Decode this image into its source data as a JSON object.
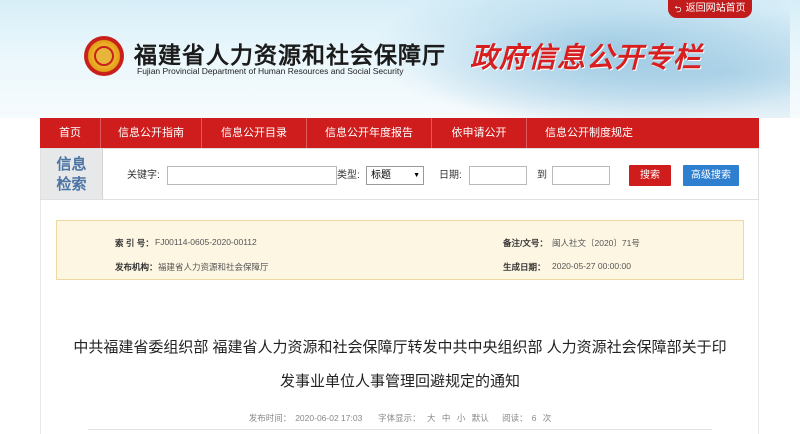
{
  "header": {
    "back_link": "返回网站首页",
    "department_cn": "福建省人力资源和社会保障厅",
    "department_en": "Fujian Provincial Department of Human Resources and Social Security",
    "column_title": "政府信息公开专栏"
  },
  "nav": {
    "items": [
      {
        "label": "首页"
      },
      {
        "label": "信息公开指南"
      },
      {
        "label": "信息公开目录"
      },
      {
        "label": "信息公开年度报告"
      },
      {
        "label": "依申请公开"
      },
      {
        "label": "信息公开制度规定"
      }
    ]
  },
  "search": {
    "title_line1": "信息",
    "title_line2": "检索",
    "keyword_label": "关键字:",
    "keyword_value": "",
    "type_label": "类型:",
    "type_selected": "标题",
    "date_label": "日期:",
    "date_from": "",
    "to_label": "到",
    "date_to": "",
    "search_button": "搜索",
    "advanced_button": "高级搜索"
  },
  "meta": {
    "index_label": "索 引 号：",
    "index_value": "FJ00114-0605-2020-00112",
    "org_label": "发布机构：",
    "org_value": "福建省人力资源和社会保障厅",
    "ref_label": "备注/文号：",
    "ref_value": "闽人社文〔2020〕71号",
    "date_label": "生成日期：",
    "date_value": "2020-05-27 00:00:00"
  },
  "document": {
    "title_line1": "中共福建省委组织部 福建省人力资源和社会保障厅转发中共中央组织部 人力资源社会保障部关于印",
    "title_line2": "发事业单位人事管理回避规定的通知",
    "published_label": "发布时间：",
    "published_value": "2020-06-02 17:03",
    "font_size_label": "字体显示：",
    "font_large": "大",
    "font_medium": "中",
    "font_small": "小",
    "font_default": "默认",
    "views_label": "阅读：",
    "views_value": "6",
    "views_unit": "次"
  },
  "colors": {
    "brand_red": "#cf1d1d",
    "advanced_blue": "#2f7fd0",
    "meta_bg": "#fdf6e2"
  }
}
